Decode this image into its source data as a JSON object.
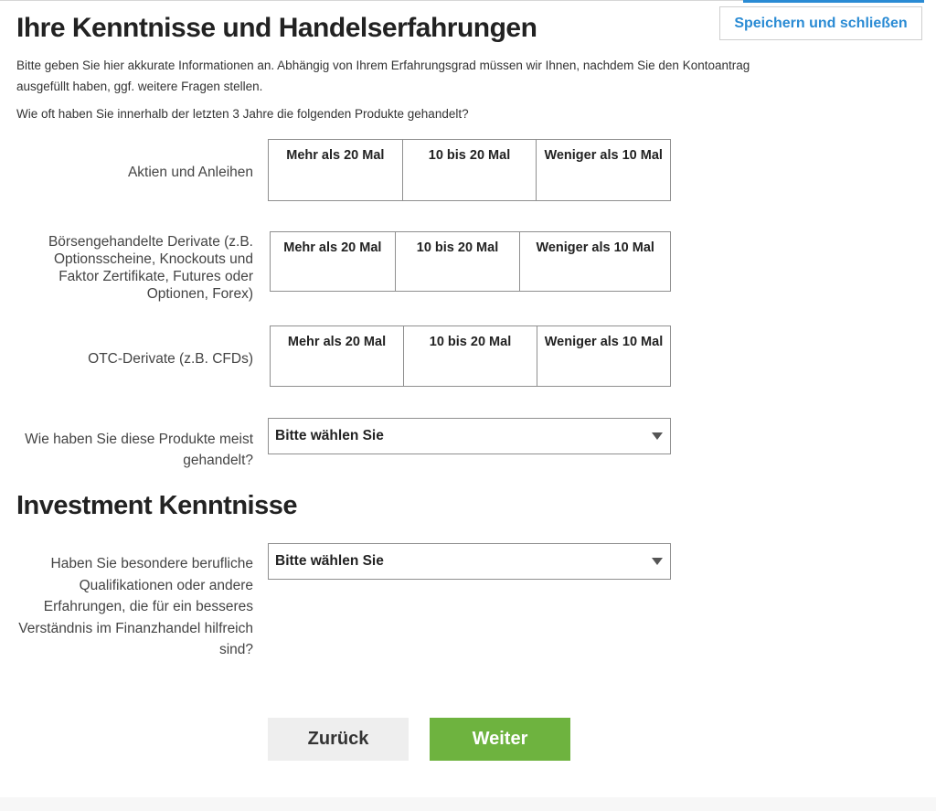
{
  "header": {
    "save_close_label": "Speichern und schließen"
  },
  "title": "Ihre Kenntnisse und Handelserfahrungen",
  "intro_line1": "Bitte geben Sie hier akkurate Informationen an. Abhängig von Ihrem Erfahrungsgrad müssen wir Ihnen, nachdem Sie den Kontoantrag",
  "intro_line2": "ausgefüllt haben, ggf. weitere Fragen stellen.",
  "frequency_question": "Wie oft haben Sie innerhalb der letzten 3 Jahre die folgenden Produkte gehandelt?",
  "products": [
    {
      "label": "Aktien und Anleihen",
      "options": [
        "Mehr als 20 Mal",
        "10 bis 20 Mal",
        "Weniger als 10 Mal"
      ]
    },
    {
      "label": "Börsengehandelte Derivate (z.B. Optionsscheine, Knockouts und Faktor Zertifikate, Futures oder Optionen, Forex)",
      "options": [
        "Mehr als 20 Mal",
        "10 bis 20 Mal",
        "Weniger als 10 Mal"
      ]
    },
    {
      "label": "OTC-Derivate (z.B. CFDs)",
      "options": [
        "Mehr als 20 Mal",
        "10 bis 20 Mal",
        "Weniger als 10 Mal"
      ]
    }
  ],
  "trading_method": {
    "label": "Wie haben Sie diese Produkte meist gehandelt?",
    "value": "Bitte wählen Sie"
  },
  "investment_section_title": "Investment Kenntnisse",
  "qualifications": {
    "label": "Haben Sie besondere berufliche Qualifikationen oder andere Erfahrungen, die für ein besseres Verständnis im Finanzhandel hilfreich sind?",
    "value": "Bitte wählen Sie"
  },
  "buttons": {
    "back": "Zurück",
    "next": "Weiter"
  },
  "colors": {
    "accent_blue": "#2a8bd4",
    "next_green": "#6eb33f",
    "back_gray": "#eeeeee"
  }
}
